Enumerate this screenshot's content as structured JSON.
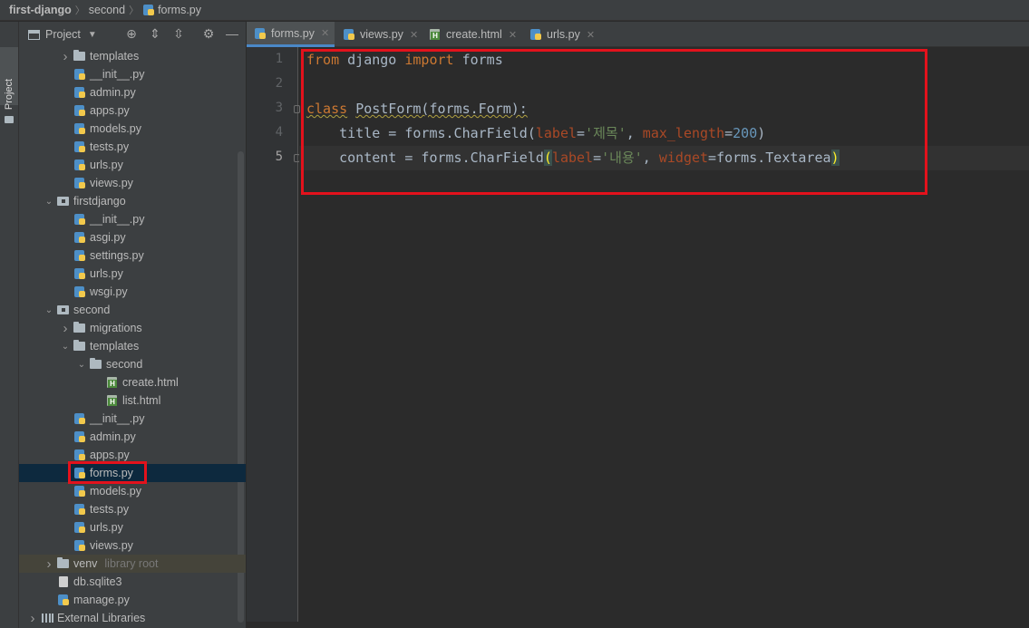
{
  "breadcrumb": [
    {
      "label": "first-django",
      "icon": "none"
    },
    {
      "label": "second",
      "icon": "none"
    },
    {
      "label": "forms.py",
      "icon": "python-file-icon"
    }
  ],
  "side_stripe": {
    "label": "Project"
  },
  "project_panel": {
    "title": "Project",
    "tools": [
      "locate-icon",
      "expand-all-icon",
      "collapse-all-icon",
      "gear-icon",
      "minimize-icon"
    ]
  },
  "tree": [
    {
      "label": "templates",
      "type": "folder",
      "depth": 2,
      "arrow": "collapsed"
    },
    {
      "label": "__init__.py",
      "type": "py",
      "depth": 2,
      "arrow": "none"
    },
    {
      "label": "admin.py",
      "type": "py",
      "depth": 2,
      "arrow": "none"
    },
    {
      "label": "apps.py",
      "type": "py",
      "depth": 2,
      "arrow": "none"
    },
    {
      "label": "models.py",
      "type": "py",
      "depth": 2,
      "arrow": "none"
    },
    {
      "label": "tests.py",
      "type": "py",
      "depth": 2,
      "arrow": "none"
    },
    {
      "label": "urls.py",
      "type": "py",
      "depth": 2,
      "arrow": "none"
    },
    {
      "label": "views.py",
      "type": "py",
      "depth": 2,
      "arrow": "none"
    },
    {
      "label": "firstdjango",
      "type": "pkg",
      "depth": 1,
      "arrow": "expanded"
    },
    {
      "label": "__init__.py",
      "type": "py",
      "depth": 2,
      "arrow": "none"
    },
    {
      "label": "asgi.py",
      "type": "py",
      "depth": 2,
      "arrow": "none"
    },
    {
      "label": "settings.py",
      "type": "py",
      "depth": 2,
      "arrow": "none"
    },
    {
      "label": "urls.py",
      "type": "py",
      "depth": 2,
      "arrow": "none"
    },
    {
      "label": "wsgi.py",
      "type": "py",
      "depth": 2,
      "arrow": "none"
    },
    {
      "label": "second",
      "type": "pkg",
      "depth": 1,
      "arrow": "expanded"
    },
    {
      "label": "migrations",
      "type": "folder",
      "depth": 2,
      "arrow": "collapsed"
    },
    {
      "label": "templates",
      "type": "folder",
      "depth": 2,
      "arrow": "expanded"
    },
    {
      "label": "second",
      "type": "folder",
      "depth": 3,
      "arrow": "expanded"
    },
    {
      "label": "create.html",
      "type": "html",
      "depth": 4,
      "arrow": "none"
    },
    {
      "label": "list.html",
      "type": "html",
      "depth": 4,
      "arrow": "none"
    },
    {
      "label": "__init__.py",
      "type": "py",
      "depth": 2,
      "arrow": "none"
    },
    {
      "label": "admin.py",
      "type": "py",
      "depth": 2,
      "arrow": "none"
    },
    {
      "label": "apps.py",
      "type": "py",
      "depth": 2,
      "arrow": "none"
    },
    {
      "label": "forms.py",
      "type": "py",
      "depth": 2,
      "arrow": "none",
      "selected": true
    },
    {
      "label": "models.py",
      "type": "py",
      "depth": 2,
      "arrow": "none"
    },
    {
      "label": "tests.py",
      "type": "py",
      "depth": 2,
      "arrow": "none"
    },
    {
      "label": "urls.py",
      "type": "py",
      "depth": 2,
      "arrow": "none"
    },
    {
      "label": "views.py",
      "type": "py",
      "depth": 2,
      "arrow": "none"
    },
    {
      "label": "venv",
      "type": "folder",
      "depth": 1,
      "arrow": "collapsed",
      "hint": "library root",
      "lib": true
    },
    {
      "label": "db.sqlite3",
      "type": "db",
      "depth": 1,
      "arrow": "none"
    },
    {
      "label": "manage.py",
      "type": "py",
      "depth": 1,
      "arrow": "none"
    },
    {
      "label": "External Libraries",
      "type": "libs",
      "depth": 0,
      "arrow": "collapsed"
    }
  ],
  "tabs": [
    {
      "label": "forms.py",
      "icon": "python-file-icon",
      "active": true
    },
    {
      "label": "views.py",
      "icon": "python-file-icon",
      "active": false
    },
    {
      "label": "create.html",
      "icon": "html-file-icon",
      "active": false
    },
    {
      "label": "urls.py",
      "icon": "python-file-icon",
      "active": false
    }
  ],
  "editor": {
    "line_numbers": [
      "1",
      "2",
      "3",
      "4",
      "5"
    ],
    "current_line": 5,
    "lines": [
      [
        {
          "t": "from",
          "c": "kw"
        },
        {
          "t": " django ",
          "c": ""
        },
        {
          "t": "import",
          "c": "kw"
        },
        {
          "t": " forms",
          "c": ""
        }
      ],
      [],
      [
        {
          "t": "class",
          "c": "kw squig"
        },
        {
          "t": " ",
          "c": ""
        },
        {
          "t": "PostForm(forms.Form):",
          "c": "squig"
        }
      ],
      [
        {
          "t": "    title = forms.CharField(",
          "c": ""
        },
        {
          "t": "label",
          "c": "param"
        },
        {
          "t": "=",
          "c": ""
        },
        {
          "t": "'제목'",
          "c": "str"
        },
        {
          "t": ", ",
          "c": ""
        },
        {
          "t": "max_length",
          "c": "param"
        },
        {
          "t": "=",
          "c": ""
        },
        {
          "t": "200",
          "c": "num"
        },
        {
          "t": ")",
          "c": ""
        }
      ],
      [
        {
          "t": "    content = forms.CharField",
          "c": ""
        },
        {
          "t": "(",
          "c": "brace"
        },
        {
          "t": "label",
          "c": "param"
        },
        {
          "t": "=",
          "c": ""
        },
        {
          "t": "'내용'",
          "c": "str"
        },
        {
          "t": ", ",
          "c": ""
        },
        {
          "t": "widget",
          "c": "param"
        },
        {
          "t": "=forms.Textarea",
          "c": ""
        },
        {
          "t": ")",
          "c": "brace"
        }
      ]
    ]
  },
  "colors": {
    "keyword": "#cc7832",
    "param": "#aa4926",
    "string": "#6a8759",
    "number": "#6897bb",
    "default": "#a9b7c6",
    "annotation_box": "#e3121c",
    "selection": "#0d293e"
  }
}
